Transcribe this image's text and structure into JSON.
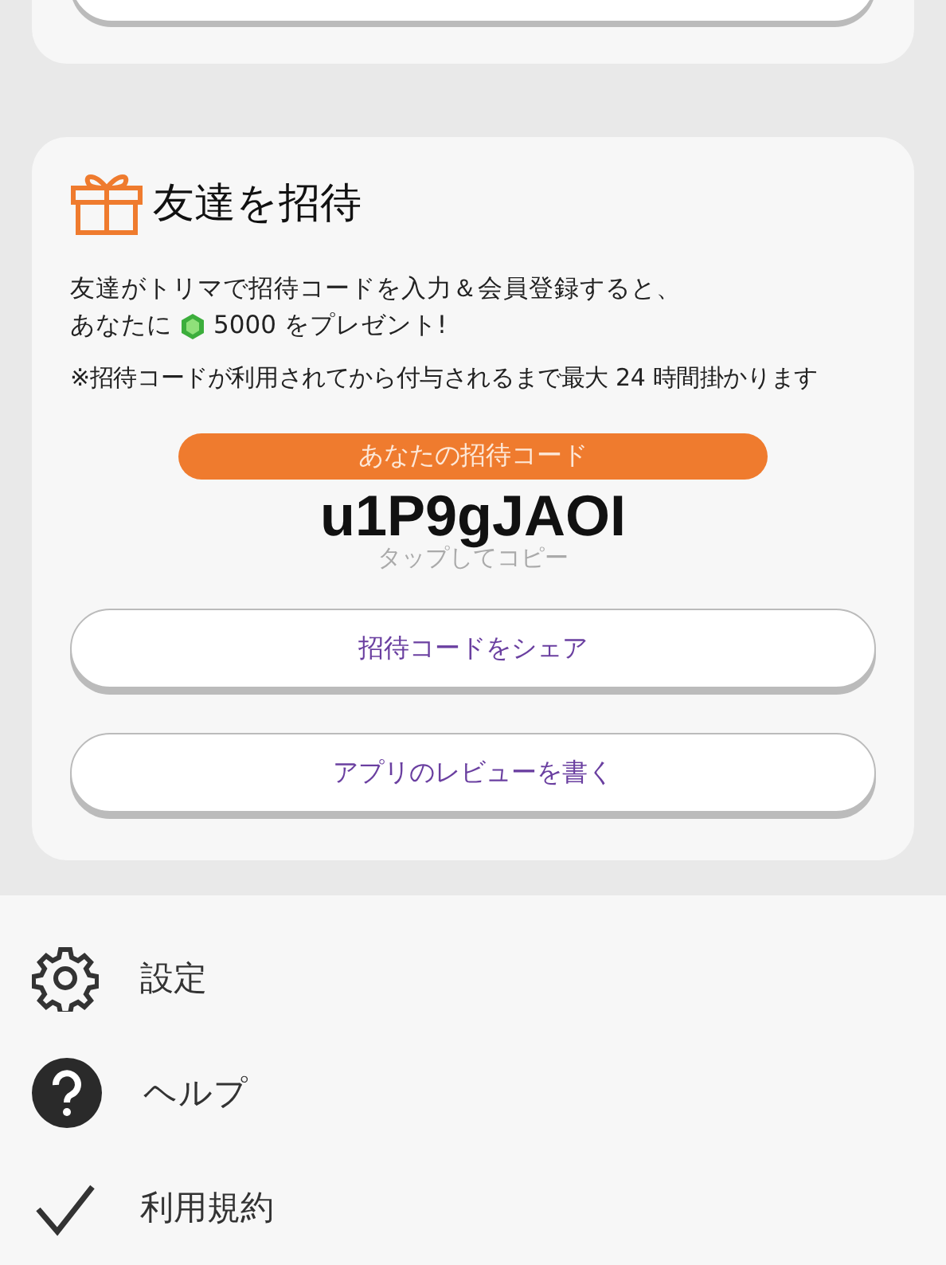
{
  "invite": {
    "title": "友達を招待",
    "description_line_1": "友達がトリマで招待コードを入力＆会員登録すると、",
    "description_line_2_before": "あなたに",
    "description_line_2_after": "5000 をプレゼント!",
    "note": "※招待コードが利用されてから付与されるまで最大 24 時間掛かります",
    "code_label": "あなたの招待コード",
    "code": "u1P9gJAOI",
    "copy_hint": "タップしてコピー",
    "buttons": [
      "招待コードをシェア",
      "アプリのレビューを書く"
    ]
  },
  "menu": [
    {
      "kind": "settings",
      "label": "設定"
    },
    {
      "kind": "help",
      "label": "ヘルプ"
    },
    {
      "kind": "check",
      "label": "利用規約"
    }
  ]
}
